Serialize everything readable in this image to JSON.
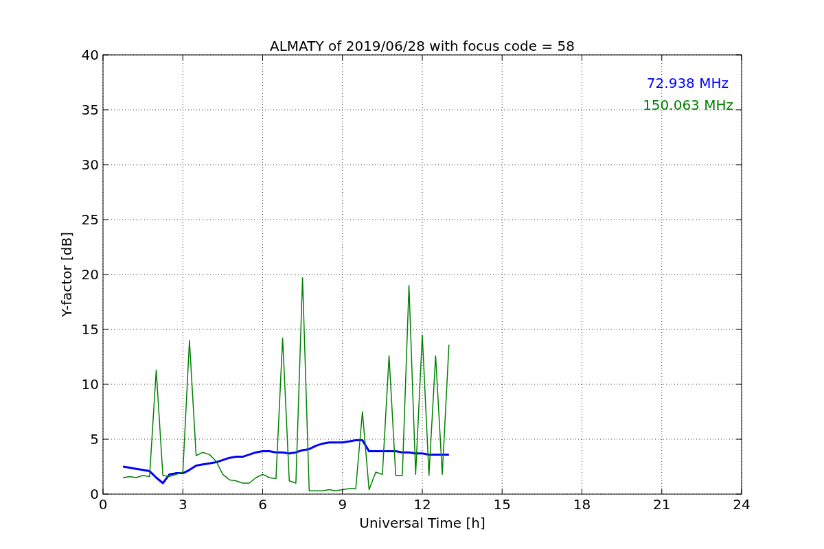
{
  "chart_data": {
    "type": "line",
    "title": "ALMATY of 2019/06/28 with focus code = 58",
    "xlabel": "Universal Time [h]",
    "ylabel": "Y-factor [dB]",
    "x": [
      0.75,
      1.0,
      1.25,
      1.5,
      1.75,
      2.0,
      2.25,
      2.5,
      2.75,
      3.0,
      3.25,
      3.5,
      3.75,
      4.0,
      4.25,
      4.5,
      4.75,
      5.0,
      5.25,
      5.5,
      5.75,
      6.0,
      6.25,
      6.5,
      6.75,
      7.0,
      7.25,
      7.5,
      7.75,
      8.0,
      8.25,
      8.5,
      8.75,
      9.0,
      9.25,
      9.5,
      9.75,
      10.0,
      10.25,
      10.5,
      10.75,
      11.0,
      11.25,
      11.5,
      11.75,
      12.0,
      12.25,
      12.5,
      12.75,
      13.0
    ],
    "series": [
      {
        "name": "72.938 MHz",
        "color": "#0000ff",
        "values": [
          2.5,
          2.4,
          2.3,
          2.2,
          2.1,
          1.5,
          1.0,
          1.8,
          1.9,
          1.9,
          2.2,
          2.6,
          2.7,
          2.8,
          2.9,
          3.1,
          3.3,
          3.4,
          3.4,
          3.6,
          3.8,
          3.9,
          3.9,
          3.8,
          3.8,
          3.7,
          3.8,
          4.0,
          4.1,
          4.4,
          4.6,
          4.7,
          4.7,
          4.7,
          4.8,
          4.9,
          4.9,
          3.9,
          3.9,
          3.9,
          3.9,
          3.9,
          3.8,
          3.8,
          3.7,
          3.7,
          3.6,
          3.6,
          3.6,
          3.6
        ]
      },
      {
        "name": "150.063 MHz",
        "color": "#008000",
        "values": [
          1.5,
          1.6,
          1.5,
          1.7,
          1.6,
          11.3,
          1.7,
          1.6,
          1.8,
          2.0,
          14.0,
          3.5,
          3.8,
          3.6,
          3.0,
          1.8,
          1.3,
          1.2,
          1.0,
          1.0,
          1.5,
          1.8,
          1.5,
          1.4,
          14.2,
          1.2,
          1.0,
          19.7,
          0.3,
          0.3,
          0.3,
          0.4,
          0.3,
          0.4,
          0.5,
          0.5,
          7.5,
          0.4,
          2.0,
          1.8,
          12.6,
          1.7,
          1.7,
          19.0,
          1.8,
          14.5,
          1.7,
          12.6,
          1.8,
          13.6
        ]
      }
    ],
    "grid": true,
    "xlim": [
      0,
      24
    ],
    "ylim": [
      0,
      40
    ],
    "xticks": [
      0,
      3,
      6,
      9,
      12,
      15,
      18,
      21,
      24
    ],
    "yticks": [
      0,
      5,
      10,
      15,
      20,
      25,
      30,
      35,
      40
    ]
  }
}
